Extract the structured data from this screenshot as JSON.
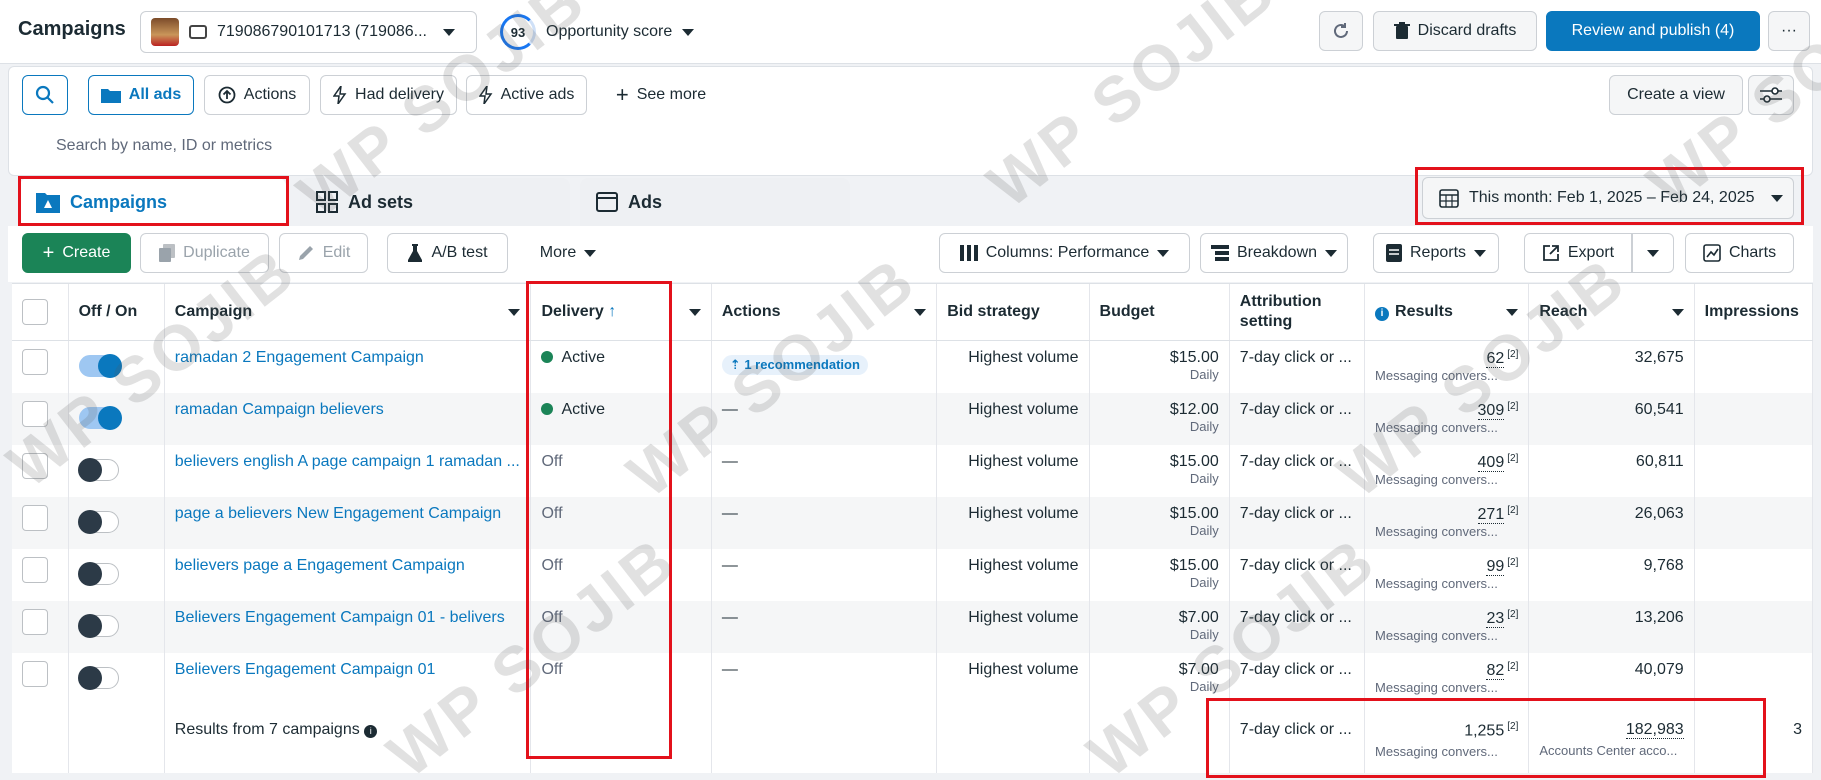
{
  "header": {
    "title": "Campaigns",
    "account_text": "719086790101713 (719086...",
    "opportunity_score": "93",
    "opportunity_label": "Opportunity score",
    "discard_label": "Discard drafts",
    "review_label": "Review and publish (4)",
    "more_label": "···"
  },
  "filters": {
    "all_ads": "All ads",
    "actions": "Actions",
    "had_delivery": "Had delivery",
    "active_ads": "Active ads",
    "see_more": "See more",
    "create_view": "Create a view",
    "search_placeholder": "Search by name, ID or metrics"
  },
  "tabs": [
    {
      "label": "Campaigns"
    },
    {
      "label": "Ad sets"
    },
    {
      "label": "Ads"
    }
  ],
  "date_range": "This month: Feb 1, 2025 – Feb 24, 2025",
  "toolbar": {
    "create": "Create",
    "duplicate": "Duplicate",
    "edit": "Edit",
    "ab_test": "A/B test",
    "more": "More",
    "columns": "Columns: Performance",
    "breakdown": "Breakdown",
    "reports": "Reports",
    "export": "Export",
    "charts": "Charts"
  },
  "table": {
    "headers": {
      "offon": "Off / On",
      "campaign": "Campaign",
      "delivery": "Delivery",
      "actions": "Actions",
      "bid": "Bid strategy",
      "budget": "Budget",
      "attribution": "Attribution setting",
      "results": "Results",
      "reach": "Reach",
      "impressions": "Impressions"
    },
    "rows": [
      {
        "name": "ramadan 2 Engagement Campaign",
        "delivery": "Active",
        "actions": "1 recommendation",
        "bid": "Highest volume",
        "budget": "$15.00",
        "budget_sub": "Daily",
        "attribution": "7-day click or ...",
        "results": "62",
        "results_sup": "[2]",
        "results_sub": "Messaging convers...",
        "reach": "32,675"
      },
      {
        "name": "ramadan Campaign believers",
        "delivery": "Active",
        "actions": "—",
        "bid": "Highest volume",
        "budget": "$12.00",
        "budget_sub": "Daily",
        "attribution": "7-day click or ...",
        "results": "309",
        "results_sup": "[2]",
        "results_sub": "Messaging convers...",
        "reach": "60,541"
      },
      {
        "name": "believers english A page campaign 1 ramadan ...",
        "delivery": "Off",
        "actions": "—",
        "bid": "Highest volume",
        "budget": "$15.00",
        "budget_sub": "Daily",
        "attribution": "7-day click or ...",
        "results": "409",
        "results_sup": "[2]",
        "results_sub": "Messaging convers...",
        "reach": "60,811"
      },
      {
        "name": "page a believers New Engagement Campaign",
        "delivery": "Off",
        "actions": "—",
        "bid": "Highest volume",
        "budget": "$15.00",
        "budget_sub": "Daily",
        "attribution": "7-day click or ...",
        "results": "271",
        "results_sup": "[2]",
        "results_sub": "Messaging convers...",
        "reach": "26,063"
      },
      {
        "name": "believers page a Engagement Campaign",
        "delivery": "Off",
        "actions": "—",
        "bid": "Highest volume",
        "budget": "$15.00",
        "budget_sub": "Daily",
        "attribution": "7-day click or ...",
        "results": "99",
        "results_sup": "[2]",
        "results_sub": "Messaging convers...",
        "reach": "9,768"
      },
      {
        "name": "Believers Engagement Campaign 01 - belivers",
        "delivery": "Off",
        "actions": "—",
        "bid": "Highest volume",
        "budget": "$7.00",
        "budget_sub": "Daily",
        "attribution": "7-day click or ...",
        "results": "23",
        "results_sup": "[2]",
        "results_sub": "Messaging convers...",
        "reach": "13,206"
      },
      {
        "name": "Believers Engagement Campaign 01",
        "delivery": "Off",
        "actions": "—",
        "bid": "Highest volume",
        "budget": "$7.00",
        "budget_sub": "Daily",
        "attribution": "7-day click or ...",
        "results": "82",
        "results_sup": "[2]",
        "results_sub": "Messaging convers...",
        "reach": "40,079"
      }
    ],
    "summary": {
      "label": "Results from 7 campaigns",
      "attribution": "7-day click or ...",
      "results": "1,255",
      "results_sup": "[2]",
      "results_sub": "Messaging convers...",
      "reach": "182,983",
      "reach_sub": "Accounts Center acco...",
      "impressions": "3"
    }
  },
  "watermark": "WP SOJIB",
  "colors": {
    "accent": "#0a78be",
    "create": "#1b8457",
    "active_dot": "#1b8457",
    "highlight": "#e3111b"
  }
}
